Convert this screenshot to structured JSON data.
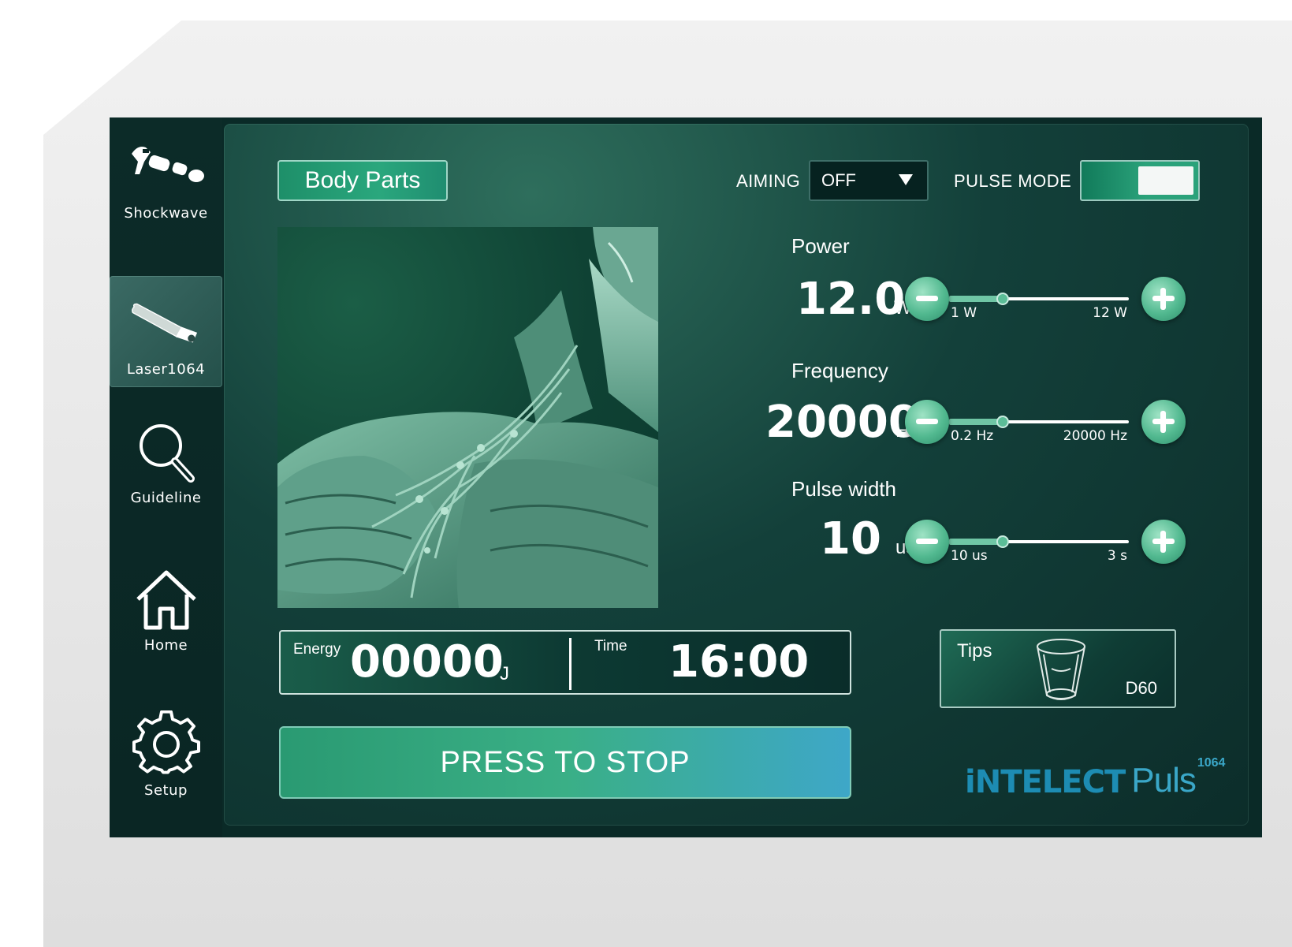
{
  "sidebar": {
    "items": [
      {
        "label": "Shockwave",
        "icon": "shockwave-handpiece-icon",
        "active": false
      },
      {
        "label": "Laser1064",
        "icon": "laser-handpiece-icon",
        "active": true
      },
      {
        "label": "Guideline",
        "icon": "search-icon",
        "active": false
      },
      {
        "label": "Home",
        "icon": "home-icon",
        "active": false
      },
      {
        "label": "Setup",
        "icon": "gear-icon",
        "active": false
      }
    ]
  },
  "header": {
    "body_parts_label": "Body Parts",
    "aiming_label": "AIMING",
    "aiming_value": "OFF",
    "pulse_mode_label": "PULSE MODE",
    "pulse_mode_on": true
  },
  "params": {
    "power": {
      "label": "Power",
      "value": "12.0",
      "unit": "W",
      "min": "1 W",
      "max": "12 W"
    },
    "frequency": {
      "label": "Frequency",
      "value": "20000",
      "unit": "Hz",
      "min": "0.2 Hz",
      "max": "20000 Hz"
    },
    "pulse_width": {
      "label": "Pulse width",
      "value": "10",
      "unit": "us",
      "min": "10 us",
      "max": "3 s"
    }
  },
  "readout": {
    "energy_label": "Energy",
    "energy_value": "00000",
    "energy_unit": "J",
    "time_label": "Time",
    "time_value": "16:00"
  },
  "stop_button": "PRESS TO STOP",
  "tips": {
    "label": "Tips",
    "model": "D60"
  },
  "brand": {
    "part1": "iNTELECT",
    "part2": "Puls",
    "superscript": "1064"
  },
  "colors": {
    "accent": "#2aa77d",
    "brand_blue": "#3aa7c8",
    "screen_bg": "#0a2a27"
  }
}
